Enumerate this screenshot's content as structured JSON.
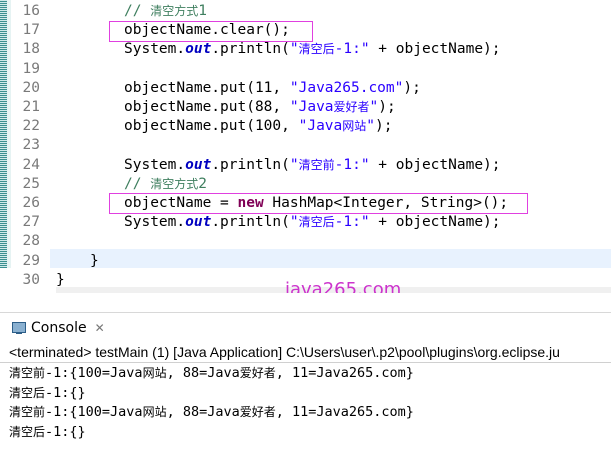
{
  "editor": {
    "lines": [
      {
        "num": "16",
        "segments": [
          {
            "t": "cmt",
            "v": "// 清空方式1"
          }
        ]
      },
      {
        "num": "17",
        "segments": [
          {
            "t": "plain",
            "v": "objectName.clear();"
          }
        ]
      },
      {
        "num": "18",
        "segments": [
          {
            "t": "plain",
            "v": "System."
          },
          {
            "t": "fld",
            "v": "out"
          },
          {
            "t": "plain",
            "v": ".println("
          },
          {
            "t": "str",
            "v": "\"清空后-1:\""
          },
          {
            "t": "plain",
            "v": " + objectName);"
          }
        ]
      },
      {
        "num": "19",
        "segments": []
      },
      {
        "num": "20",
        "segments": [
          {
            "t": "plain",
            "v": "objectName.put(11, "
          },
          {
            "t": "str",
            "v": "\"Java265.com\""
          },
          {
            "t": "plain",
            "v": ");"
          }
        ]
      },
      {
        "num": "21",
        "segments": [
          {
            "t": "plain",
            "v": "objectName.put(88, "
          },
          {
            "t": "str",
            "v": "\"Java爱好者\""
          },
          {
            "t": "plain",
            "v": ");"
          }
        ]
      },
      {
        "num": "22",
        "segments": [
          {
            "t": "plain",
            "v": "objectName.put(100, "
          },
          {
            "t": "str",
            "v": "\"Java网站\""
          },
          {
            "t": "plain",
            "v": ");"
          }
        ]
      },
      {
        "num": "23",
        "segments": []
      },
      {
        "num": "24",
        "segments": [
          {
            "t": "plain",
            "v": "System."
          },
          {
            "t": "fld",
            "v": "out"
          },
          {
            "t": "plain",
            "v": ".println("
          },
          {
            "t": "str",
            "v": "\"清空前-1:\""
          },
          {
            "t": "plain",
            "v": " + objectName);"
          }
        ]
      },
      {
        "num": "25",
        "segments": [
          {
            "t": "cmt",
            "v": "// 清空方式2"
          }
        ]
      },
      {
        "num": "26",
        "segments": [
          {
            "t": "plain",
            "v": "objectName = "
          },
          {
            "t": "kw",
            "v": "new"
          },
          {
            "t": "plain",
            "v": " HashMap<Integer, String>();"
          }
        ]
      },
      {
        "num": "27",
        "segments": [
          {
            "t": "plain",
            "v": "System."
          },
          {
            "t": "fld",
            "v": "out"
          },
          {
            "t": "plain",
            "v": ".println("
          },
          {
            "t": "str",
            "v": "\"清空后-1:\""
          },
          {
            "t": "plain",
            "v": " + objectName);"
          }
        ]
      },
      {
        "num": "28",
        "segments": []
      },
      {
        "num": "29",
        "segments": [
          {
            "t": "plain",
            "v": "}"
          }
        ]
      },
      {
        "num": "30",
        "segments": [
          {
            "t": "plain",
            "v": "}"
          }
        ]
      }
    ],
    "watermark": "java265.com"
  },
  "console": {
    "tab_label": "Console",
    "tab_close": "✕",
    "terminated": "<terminated> testMain (1) [Java Application] C:\\Users\\user\\.p2\\pool\\plugins\\org.eclipse.ju",
    "output": [
      "清空前-1:{100=Java网站, 88=Java爱好者, 11=Java265.com}",
      "清空后-1:{}",
      "清空前-1:{100=Java网站, 88=Java爱好者, 11=Java265.com}",
      "清空后-1:{}"
    ]
  },
  "colors": {
    "comment": "#3f7f5f",
    "string": "#2a00ff",
    "keyword": "#7f0055",
    "field": "#0000c0",
    "highlight_box": "#e040e0",
    "watermark": "#cc33cc"
  }
}
